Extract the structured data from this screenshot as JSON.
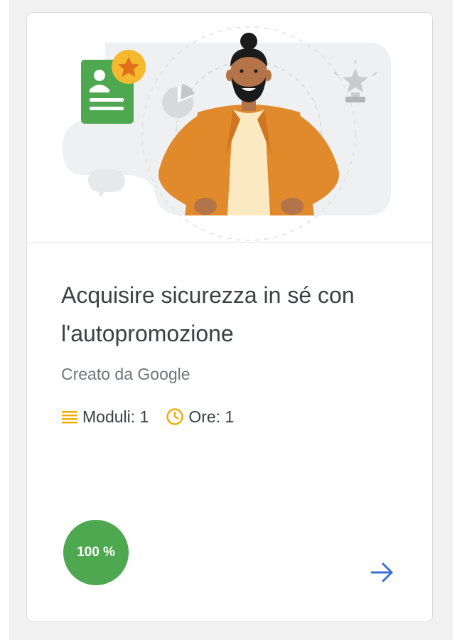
{
  "course": {
    "title": "Acquisire sicurezza in sé con l'autopromozione",
    "author": "Creato da Google",
    "modules_label": "Moduli: 1",
    "hours_label": "Ore: 1",
    "progress_label": "100 %",
    "progress_value": 100
  },
  "icons": {
    "modules": "list-lines-icon",
    "hours": "clock-icon",
    "open": "arrow-right-icon"
  },
  "colors": {
    "accent_icon": "#f2a900",
    "progress_green": "#4ea850",
    "arrow_blue": "#3b6fd8",
    "title_text": "#3c4043",
    "secondary_text": "#70757a"
  }
}
